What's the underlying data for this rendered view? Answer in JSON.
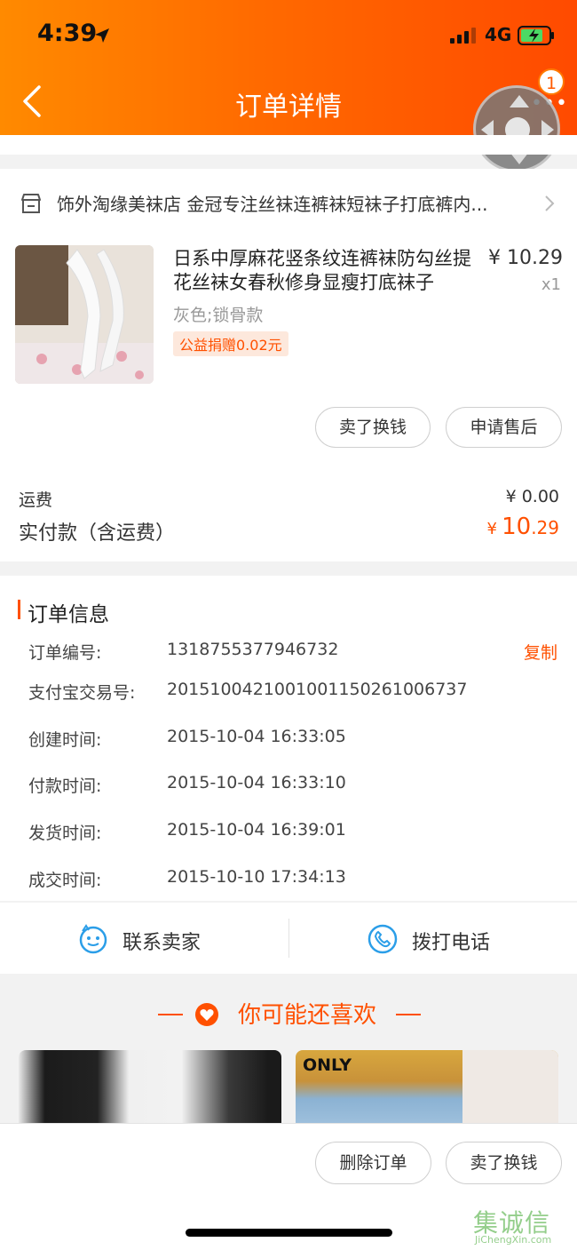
{
  "status_bar": {
    "time": "4:39",
    "network": "4G"
  },
  "header": {
    "title": "订单详情",
    "badge_count": "1"
  },
  "store": {
    "name": "饰外淘缘美袜店 金冠专注丝袜连裤袜短袜子打底裤内..."
  },
  "product": {
    "title": "日系中厚麻花竖条纹连裤袜防勾丝提花丝袜女春秋修身显瘦打底袜子",
    "price": "¥ 10.29",
    "quantity": "x1",
    "sku": "灰色;锁骨款",
    "charity": "公益捐赠0.02元"
  },
  "item_actions": {
    "sell": "卖了换钱",
    "after_sales": "申请售后"
  },
  "summary": {
    "shipping_label": "运费",
    "shipping_value": "¥ 0.00",
    "paid_label": "实付款（含运费）",
    "paid_currency": "¥",
    "paid_integer": "10",
    "paid_decimal": ".29"
  },
  "order_info": {
    "title": "订单信息",
    "copy_label": "复制",
    "rows": [
      {
        "label": "订单编号:",
        "value": "1318755377946732"
      },
      {
        "label": "支付宝交易号:",
        "value": "2015100421001001150261006737"
      },
      {
        "label": "创建时间:",
        "value": "2015-10-04 16:33:05"
      },
      {
        "label": "付款时间:",
        "value": "2015-10-04 16:33:10"
      },
      {
        "label": "发货时间:",
        "value": "2015-10-04 16:39:01"
      },
      {
        "label": "成交时间:",
        "value": "2015-10-10 17:34:13"
      }
    ]
  },
  "contact": {
    "seller": "联系卖家",
    "call": "拨打电话"
  },
  "recommend": {
    "title": "你可能还喜欢",
    "card_b_brand": "ONLY"
  },
  "bottom_actions": {
    "delete": "删除订单",
    "sell": "卖了换钱"
  },
  "watermark": {
    "cn": "集诚信",
    "en": "JiChengXin.com"
  },
  "colors": {
    "accent": "#ff5000",
    "header_start": "#ff8a00",
    "header_end": "#ff4a00"
  }
}
